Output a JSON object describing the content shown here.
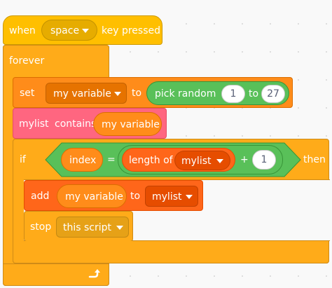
{
  "hat": {
    "when": "when",
    "key": "space",
    "suffix": "key pressed"
  },
  "forever": {
    "label": "forever"
  },
  "set_block": {
    "label": "set",
    "variable": "my variable",
    "to": "to"
  },
  "pick_random": {
    "label": "pick random",
    "from": "1",
    "to_label": "to",
    "to": "27"
  },
  "contains_block": {
    "list": "mylist",
    "label": "contains",
    "item": "my variable"
  },
  "if_block": {
    "if": "if",
    "then": "then"
  },
  "condition": {
    "left": "index",
    "op": "=",
    "length_label": "length of",
    "length_list": "mylist",
    "plus": "+",
    "addend": "1"
  },
  "add_block": {
    "label": "add",
    "item": "my variable",
    "to": "to",
    "list": "mylist"
  },
  "stop_block": {
    "label": "stop",
    "option": "this script"
  },
  "colors": {
    "events": "#FFBF00",
    "control": "#FFAB19",
    "variables": "#FF8C1A",
    "lists": "#FF661A",
    "operators": "#59C059"
  }
}
